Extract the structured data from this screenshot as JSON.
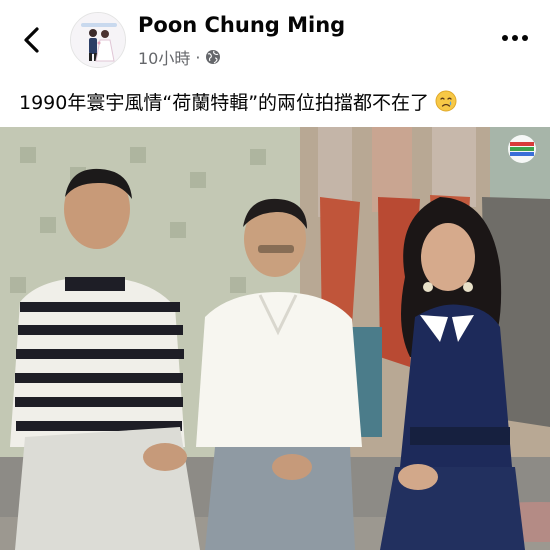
{
  "post": {
    "author": "Poon Chung Ming",
    "time": "10小時",
    "separator": "·",
    "privacy_icon": "globe-icon",
    "caption": "1990年寰宇風情“荷蘭特輯”的兩位拍擋都不在了",
    "caption_emoji": "crying-face-emoji"
  },
  "header": {
    "back_icon": "chevron-left-icon",
    "more_icon": "more-horizontal-icon"
  },
  "photo": {
    "description_icon": "tv-channel-logo"
  },
  "colors": {
    "text": "#050505",
    "meta": "#65676b",
    "background": "#ffffff"
  }
}
